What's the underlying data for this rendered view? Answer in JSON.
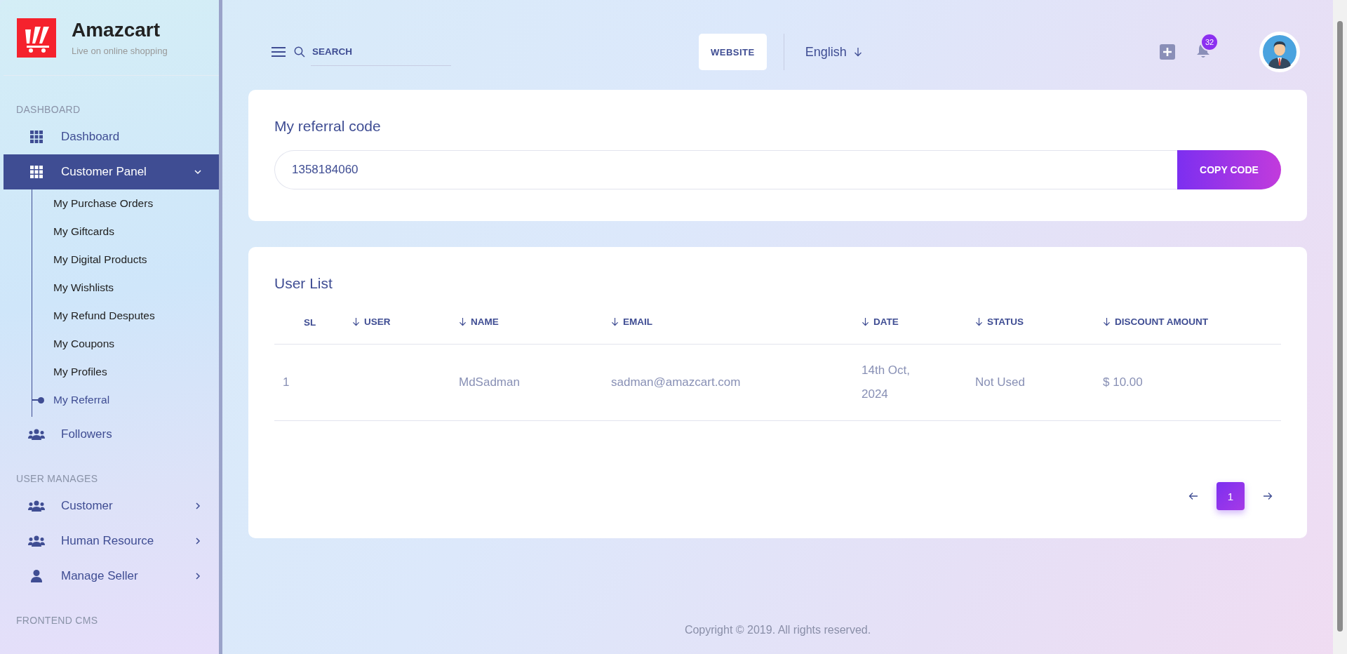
{
  "sidebar": {
    "logo": {
      "title": "Amazcart",
      "tagline": "Live on online shopping"
    },
    "sections": [
      {
        "heading": "DASHBOARD",
        "items": [
          {
            "label": "Dashboard",
            "kind": "grid",
            "selected": false
          },
          {
            "label": "Customer Panel",
            "kind": "grid",
            "selected": true,
            "expanded": true,
            "children": [
              {
                "label": "My Purchase Orders",
                "selected": false
              },
              {
                "label": "My Giftcards",
                "selected": false
              },
              {
                "label": "My Digital Products",
                "selected": false
              },
              {
                "label": "My Wishlists",
                "selected": false
              },
              {
                "label": "My Refund Desputes",
                "selected": false
              },
              {
                "label": "My Coupons",
                "selected": false
              },
              {
                "label": "My Profiles",
                "selected": false
              },
              {
                "label": "My Referral",
                "selected": true
              }
            ]
          },
          {
            "label": "Followers",
            "kind": "group",
            "selected": false
          }
        ]
      },
      {
        "heading": "USER MANAGES",
        "items": [
          {
            "label": "Customer",
            "kind": "group",
            "selected": false,
            "expanded": false
          },
          {
            "label": "Human Resource",
            "kind": "group",
            "selected": false,
            "expanded": false
          },
          {
            "label": "Manage Seller",
            "kind": "person",
            "selected": false,
            "expanded": false
          }
        ]
      },
      {
        "heading": "FRONTEND CMS"
      }
    ]
  },
  "header": {
    "search": {
      "placeholder": "SEARCH"
    },
    "website_button": "WEBSITE",
    "language": "English",
    "notification_count": "32"
  },
  "referral": {
    "title": "My referral code",
    "code": "1358184060",
    "button": "COPY CODE"
  },
  "user_list": {
    "title": "User List",
    "columns": [
      {
        "label": "SL",
        "sortable": false
      },
      {
        "label": "USER",
        "sortable": true
      },
      {
        "label": "NAME",
        "sortable": true
      },
      {
        "label": "EMAIL",
        "sortable": true
      },
      {
        "label": "DATE",
        "sortable": true
      },
      {
        "label": "STATUS",
        "sortable": true
      },
      {
        "label": "DISCOUNT AMOUNT",
        "sortable": true
      }
    ],
    "rows": [
      [
        "1",
        "",
        "MdSadman",
        "sadman@amazcart.com",
        "14th Oct, 2024",
        "Not Used",
        "$ 10.00"
      ]
    ],
    "pages": [
      {
        "label": "1",
        "selected": true
      }
    ]
  },
  "footer": "Copyright © 2019. All rights reserved."
}
